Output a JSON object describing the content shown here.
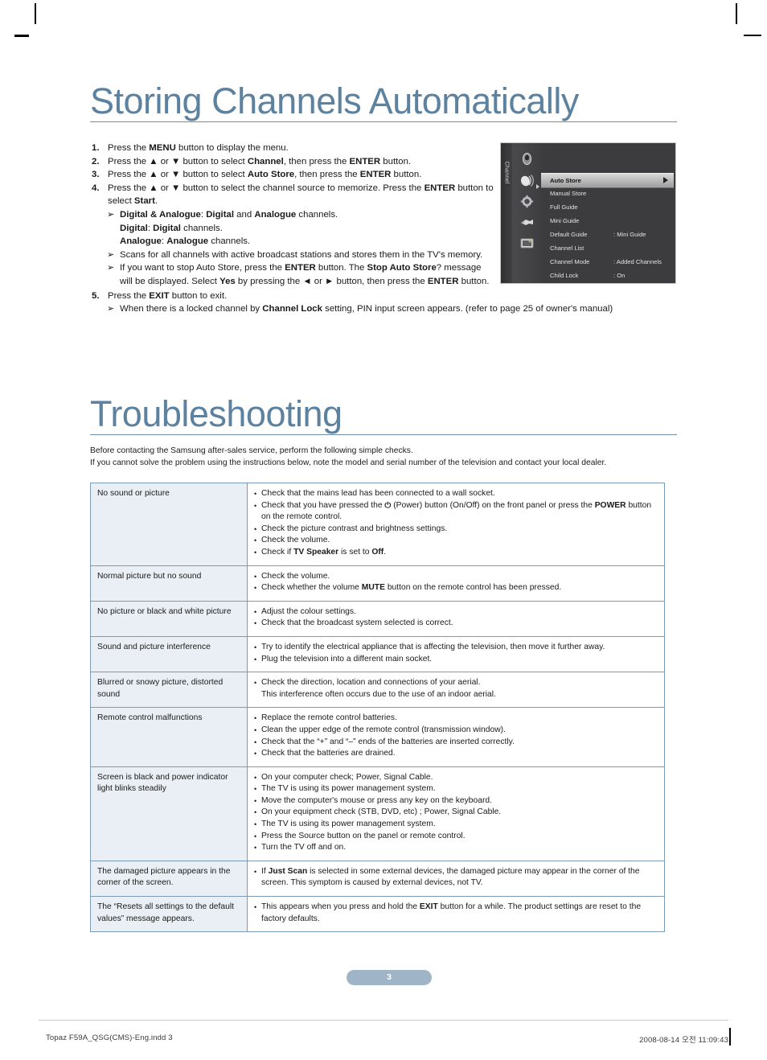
{
  "sections": {
    "storing": {
      "title": "Storing Channels Automatically",
      "steps": [
        {
          "num": "1.",
          "parts": [
            {
              "t": "Press the "
            },
            {
              "t": "MENU",
              "b": true
            },
            {
              "t": " button to display the menu."
            }
          ]
        },
        {
          "num": "2.",
          "parts": [
            {
              "t": "Press the ▲ or ▼ button to select "
            },
            {
              "t": "Channel",
              "b": true
            },
            {
              "t": ", then press the "
            },
            {
              "t": "ENTER",
              "b": true
            },
            {
              "t": " button."
            }
          ]
        },
        {
          "num": "3.",
          "parts": [
            {
              "t": "Press the ▲ or ▼ button to select "
            },
            {
              "t": "Auto Store",
              "b": true
            },
            {
              "t": ", then press the "
            },
            {
              "t": "ENTER",
              "b": true
            },
            {
              "t": " button."
            }
          ]
        },
        {
          "num": "4.",
          "parts": [
            {
              "t": "Press the ▲ or ▼ button to select the channel source to memorize. Press the "
            },
            {
              "t": "ENTER",
              "b": true
            },
            {
              "t": " button to select "
            },
            {
              "t": "Start",
              "b": true
            },
            {
              "t": "."
            }
          ]
        },
        {
          "num": "5.",
          "parts": [
            {
              "t": "Press the "
            },
            {
              "t": "EXIT",
              "b": true
            },
            {
              "t": " button to exit."
            }
          ]
        }
      ],
      "sub_marker": "➢",
      "step4_notes": [
        {
          "marker": true,
          "parts": [
            {
              "t": "Digital & Analogue",
              "b": true
            },
            {
              "t": ": "
            },
            {
              "t": "Digital",
              "b": true
            },
            {
              "t": " and "
            },
            {
              "t": "Analogue",
              "b": true
            },
            {
              "t": " channels."
            }
          ]
        },
        {
          "marker": false,
          "parts": [
            {
              "t": "Digital",
              "b": true
            },
            {
              "t": ": "
            },
            {
              "t": "Digital",
              "b": true
            },
            {
              "t": " channels."
            }
          ]
        },
        {
          "marker": false,
          "parts": [
            {
              "t": "Analogue",
              "b": true
            },
            {
              "t": ": "
            },
            {
              "t": "Analogue",
              "b": true
            },
            {
              "t": " channels."
            }
          ]
        },
        {
          "marker": true,
          "parts": [
            {
              "t": "Scans for all channels with active broadcast stations and stores them in the TV's memory."
            }
          ]
        },
        {
          "marker": true,
          "parts": [
            {
              "t": "If you want to stop Auto Store, press the "
            },
            {
              "t": "ENTER",
              "b": true
            },
            {
              "t": " button. The "
            },
            {
              "t": "Stop Auto Store",
              "b": true
            },
            {
              "t": "? message will be displayed. Select "
            },
            {
              "t": "Yes",
              "b": true
            },
            {
              "t": " by pressing the ◄ or ► button, then press the "
            },
            {
              "t": "ENTER",
              "b": true
            },
            {
              "t": " button."
            }
          ]
        }
      ],
      "step5_notes": [
        {
          "marker": true,
          "parts": [
            {
              "t": "When there is a locked channel by "
            },
            {
              "t": "Channel Lock",
              "b": true
            },
            {
              "t": " setting, PIN input screen appears. (refer to page 25 of owner's manual)"
            }
          ]
        }
      ]
    },
    "troubleshooting": {
      "title": "Troubleshooting",
      "intro_line_1": "Before contacting the Samsung after-sales service, perform the following simple checks.",
      "intro_line_2": "If you cannot solve the problem using the instructions below, note the model and serial number of the television and contact your local dealer.",
      "bullet": "•",
      "rows": [
        {
          "symptom": "No sound or picture",
          "fixes": [
            [
              {
                "t": "Check that the mains lead has been connected to a wall socket."
              }
            ],
            [
              {
                "t": "Check that you have pressed the "
              },
              {
                "t": "⏻",
                "icon": true
              },
              {
                "t": " (Power) button (On/Off) on the front panel or press the "
              },
              {
                "t": "POWER",
                "b": true
              },
              {
                "t": " button on the remote control."
              }
            ],
            [
              {
                "t": "Check the picture contrast and brightness settings."
              }
            ],
            [
              {
                "t": "Check the volume."
              }
            ],
            [
              {
                "t": "Check if "
              },
              {
                "t": "TV Speaker",
                "b": true
              },
              {
                "t": " is set to "
              },
              {
                "t": "Off",
                "b": true
              },
              {
                "t": "."
              }
            ]
          ]
        },
        {
          "symptom": "Normal picture but no sound",
          "fixes": [
            [
              {
                "t": "Check the volume."
              }
            ],
            [
              {
                "t": "Check whether the volume "
              },
              {
                "t": "MUTE",
                "b": true
              },
              {
                "t": " button on the remote control has been pressed."
              }
            ]
          ]
        },
        {
          "symptom": "No picture or black and white picture",
          "fixes": [
            [
              {
                "t": "Adjust the colour settings."
              }
            ],
            [
              {
                "t": "Check that the broadcast system selected is correct."
              }
            ]
          ]
        },
        {
          "symptom": "Sound and picture interference",
          "fixes": [
            [
              {
                "t": "Try to identify the electrical appliance that is affecting the television, then move it further away."
              }
            ],
            [
              {
                "t": "Plug the television into a different main socket."
              }
            ]
          ]
        },
        {
          "symptom": "Blurred or snowy picture, distorted sound",
          "fixes": [
            [
              {
                "t": "Check the direction, location and connections of your aerial."
              }
            ],
            [
              {
                "t": "This interference often occurs due to the use of an indoor aerial.",
                "cont": true
              }
            ]
          ]
        },
        {
          "symptom": "Remote control malfunctions",
          "fixes": [
            [
              {
                "t": "Replace the remote control batteries."
              }
            ],
            [
              {
                "t": "Clean the upper edge of the remote control (transmission window)."
              }
            ],
            [
              {
                "t": "Check that the “+” and “–” ends of the batteries are inserted correctly."
              }
            ],
            [
              {
                "t": "Check that the batteries are drained."
              }
            ]
          ]
        },
        {
          "symptom": "Screen is black and power indicator light blinks steadily",
          "fixes": [
            [
              {
                "t": "On your computer check; Power, Signal Cable."
              }
            ],
            [
              {
                "t": "The TV is using its power management system."
              }
            ],
            [
              {
                "t": "Move the computer's mouse or press any key on the keyboard."
              }
            ],
            [
              {
                "t": "On your equipment check (STB, DVD, etc) ; Power, Signal Cable."
              }
            ],
            [
              {
                "t": "The TV is using its power management system."
              }
            ],
            [
              {
                "t": "Press the Source button on the panel or remote control."
              }
            ],
            [
              {
                "t": "Turn the TV off and on."
              }
            ]
          ]
        },
        {
          "symptom": "The damaged picture appears in the corner of the screen.",
          "fixes": [
            [
              {
                "t": "If "
              },
              {
                "t": "Just Scan",
                "b": true
              },
              {
                "t": " is selected in some external devices, the damaged picture may appear in the corner of the screen. This symptom is caused by external devices, not TV."
              }
            ]
          ]
        },
        {
          "symptom": "The “Resets all settings to the default values” message appears.",
          "fixes": [
            [
              {
                "t": "This appears when you press and hold the "
              },
              {
                "t": "EXIT",
                "b": true
              },
              {
                "t": " button for a while. The product settings are reset to the factory defaults."
              }
            ]
          ]
        }
      ]
    }
  },
  "osd": {
    "tab_label": "Channel",
    "icons": [
      "picture-icon",
      "sound-icon",
      "setup-icon",
      "input-icon",
      "support-icon"
    ],
    "rows": [
      {
        "label": "Auto Store",
        "value": "",
        "selected": true
      },
      {
        "label": "Manual Store",
        "value": "",
        "selected": false
      },
      {
        "label": "Full Guide",
        "value": "",
        "selected": false
      },
      {
        "label": "Mini Guide",
        "value": "",
        "selected": false
      },
      {
        "label": "Default Guide",
        "value": ": Mini Guide",
        "selected": false
      },
      {
        "label": "Channel List",
        "value": "",
        "selected": false
      },
      {
        "label": "Channel Mode",
        "value": ": Added Channels",
        "selected": false
      },
      {
        "label": "Child Lock",
        "value": ": On",
        "selected": false
      }
    ]
  },
  "page_number": "3",
  "footer": {
    "file": "Topaz F59A_QSG(CMS)-Eng.indd   3",
    "timestamp": "2008-08-14   오전 11:09:43"
  },
  "colors": {
    "title": "#5d829f",
    "table_border": "#7b9ab5",
    "symptom_bg": "#e9eff4",
    "page_pill": "#9fb4c6"
  }
}
